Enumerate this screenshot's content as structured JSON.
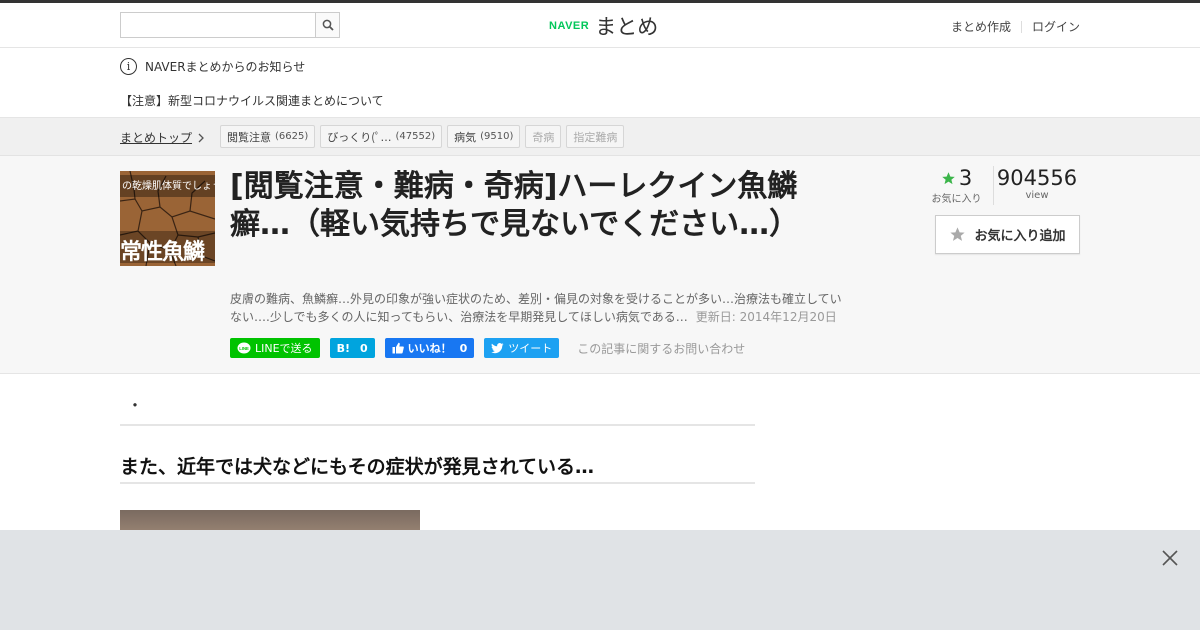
{
  "header": {
    "search_placeholder": "",
    "logo_naver": "NAVER",
    "logo_matome": "まとめ",
    "nav": [
      "まとめ作成",
      "ログイン"
    ]
  },
  "notice": {
    "title": "NAVERまとめからのお知らせ",
    "item": "【注意】新型コロナウイルス関連まとめについて"
  },
  "breadcrumb": {
    "top": "まとめトップ"
  },
  "tags": [
    {
      "label": "閲覧注意",
      "count": "(6625)"
    },
    {
      "label": "びっくり(ﾟ…",
      "count": "(47552)"
    },
    {
      "label": "病気",
      "count": "(9510)"
    },
    {
      "label": "奇病",
      "count": ""
    },
    {
      "label": "指定難病",
      "count": ""
    }
  ],
  "article": {
    "thumb_text_top": "の乾燥肌体質でしょうか",
    "thumb_text_bottom": "常性魚鱗",
    "title": "[閲覧注意・難病・奇病]ハーレクイン魚鱗癬…（軽い気持ちで見ないでください…）",
    "description": "皮膚の難病、魚鱗癬…外見の印象が強い症状のため、差別・偏見の対象を受けることが多い…治療法も確立していない….少しでも多くの人に知ってもらい、治療法を早期発見してほしい病気である…",
    "updated": "更新日: 2014年12月20日",
    "fav_count": "3",
    "fav_label": "お気に入り",
    "view_count": "904556",
    "view_label": "view",
    "fav_button": "お気に入り追加"
  },
  "social": {
    "line": "LINEで送る",
    "hatena_icon": "B!",
    "hatena_count": "0",
    "fb_label": "いいね！",
    "fb_count": "0",
    "tweet": "ツイート",
    "inquiry": "この記事に関するお問い合わせ"
  },
  "content": {
    "bullet": "・",
    "heading": "また、近年では犬などにもその症状が発見されている…"
  },
  "colors": {
    "line_green": "#00c300",
    "hatena_blue": "#00a4de",
    "fb_blue": "#1877f2",
    "twitter_blue": "#1da1f2",
    "naver_green": "#03c75a",
    "star_green": "#3bb54a"
  }
}
